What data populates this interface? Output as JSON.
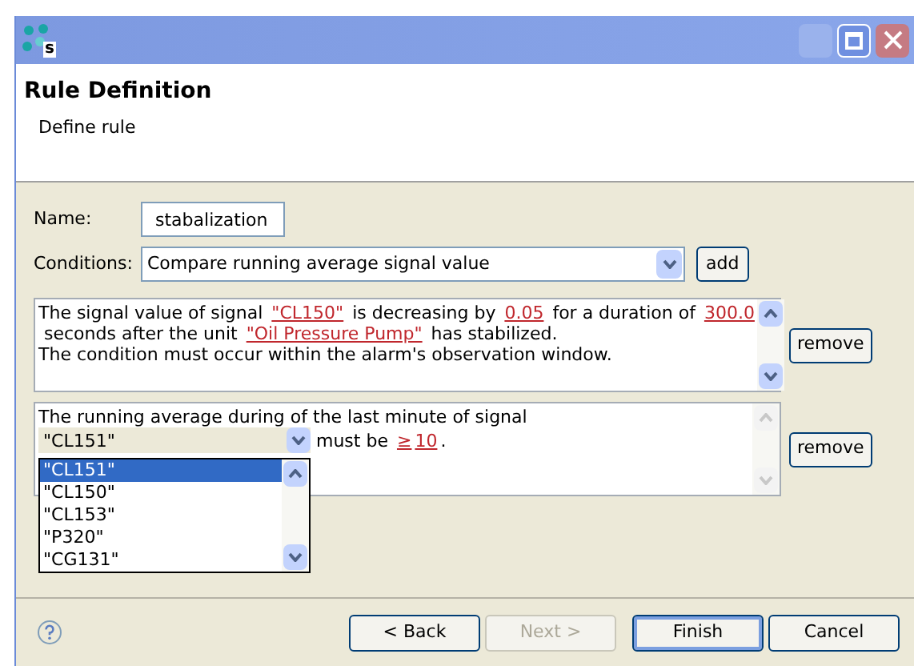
{
  "window": {
    "icon_letter": "s",
    "title": "Rule Definition",
    "subtitle": "Define rule"
  },
  "name_field": {
    "label": "Name:",
    "value": "stabalization"
  },
  "conditions_field": {
    "label": "Conditions:",
    "value": "Compare running average signal value",
    "button": "add"
  },
  "conditions": [
    {
      "lines": [
        [
          {
            "kind": "text",
            "text": "The signal value of signal "
          },
          {
            "kind": "link",
            "text": "\"CL150\""
          },
          {
            "kind": "text",
            "text": " is decreasing by "
          },
          {
            "kind": "link",
            "text": "0.05"
          },
          {
            "kind": "text",
            "text": " for a duration of "
          },
          {
            "kind": "link",
            "text": "300.0"
          }
        ],
        [
          {
            "kind": "text",
            "text": " seconds after the unit "
          },
          {
            "kind": "link",
            "text": "\"Oil Pressure Pump\""
          },
          {
            "kind": "text",
            "text": " has stabilized."
          }
        ],
        [
          {
            "kind": "text",
            "text": "The condition must occur within the alarm's observation window."
          }
        ]
      ],
      "button": "remove",
      "scroll_enabled": true
    },
    {
      "lines": [
        [
          {
            "kind": "text",
            "text": "The running average during of the last minute of signal"
          }
        ],
        [
          {
            "kind": "select",
            "value": "\"CL151\"",
            "options": [
              {
                "text": "\"CL151\"",
                "selected": true
              },
              {
                "text": "\"CL150\"",
                "selected": false
              },
              {
                "text": "\"CL153\"",
                "selected": false
              },
              {
                "text": "\"P320\"",
                "selected": false
              },
              {
                "text": "\"CG131\"",
                "selected": false
              }
            ]
          },
          {
            "kind": "text",
            "text": " must be "
          },
          {
            "kind": "link",
            "text": "≥"
          },
          {
            "kind": "link",
            "text": "10"
          },
          {
            "kind": "text",
            "text": "."
          }
        ]
      ],
      "button": "remove",
      "scroll_enabled": false
    }
  ],
  "buttons": [
    {
      "label": "< Back",
      "disabled": false,
      "default": false
    },
    {
      "label": "Next >",
      "disabled": true,
      "default": false
    },
    {
      "label": "Finish",
      "disabled": false,
      "default": true
    },
    {
      "label": "Cancel",
      "disabled": false,
      "default": false
    }
  ]
}
